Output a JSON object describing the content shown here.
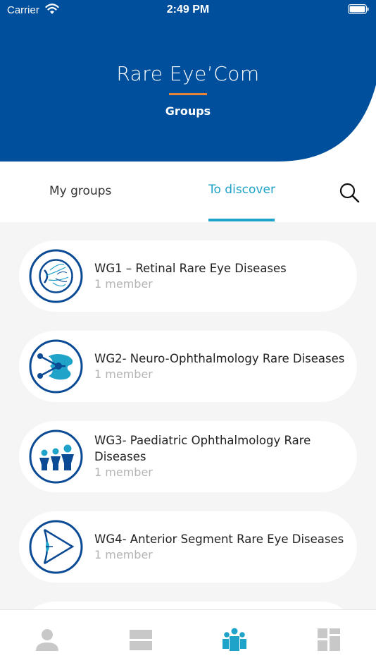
{
  "status_bar": {
    "carrier": "Carrier",
    "time": "2:49 PM"
  },
  "header": {
    "app_title": "Rare Eye’Com",
    "subtitle": "Groups"
  },
  "tabs": [
    {
      "label": "My groups",
      "active": false
    },
    {
      "label": "To discover",
      "active": true
    }
  ],
  "groups": [
    {
      "title": "WG1 – Retinal Rare Eye Diseases",
      "title_line2": "",
      "members": "1 member",
      "icon": "retina-eye-icon"
    },
    {
      "title": "WG2- Neuro-Ophthalmology Rare Diseases",
      "title_line2": "",
      "members": "1 member",
      "icon": "optic-nerve-icon"
    },
    {
      "title": "WG3- Paediatric Ophthalmology Rare",
      "title_line2": "Diseases",
      "members": "1 member",
      "icon": "children-group-icon"
    },
    {
      "title": "WG4- Anterior Segment Rare Eye Diseases",
      "title_line2": "",
      "members": "1 member",
      "icon": "anterior-eye-icon"
    }
  ],
  "bottom_nav": [
    {
      "icon": "profile-icon",
      "active": false
    },
    {
      "icon": "feed-icon",
      "active": false
    },
    {
      "icon": "groups-icon",
      "active": true
    },
    {
      "icon": "dashboard-icon",
      "active": false
    }
  ],
  "colors": {
    "brand_blue": "#004f9c",
    "accent_orange": "#e8843a",
    "active_teal": "#1fa3c8",
    "inactive_gray": "#c8c8c8"
  }
}
